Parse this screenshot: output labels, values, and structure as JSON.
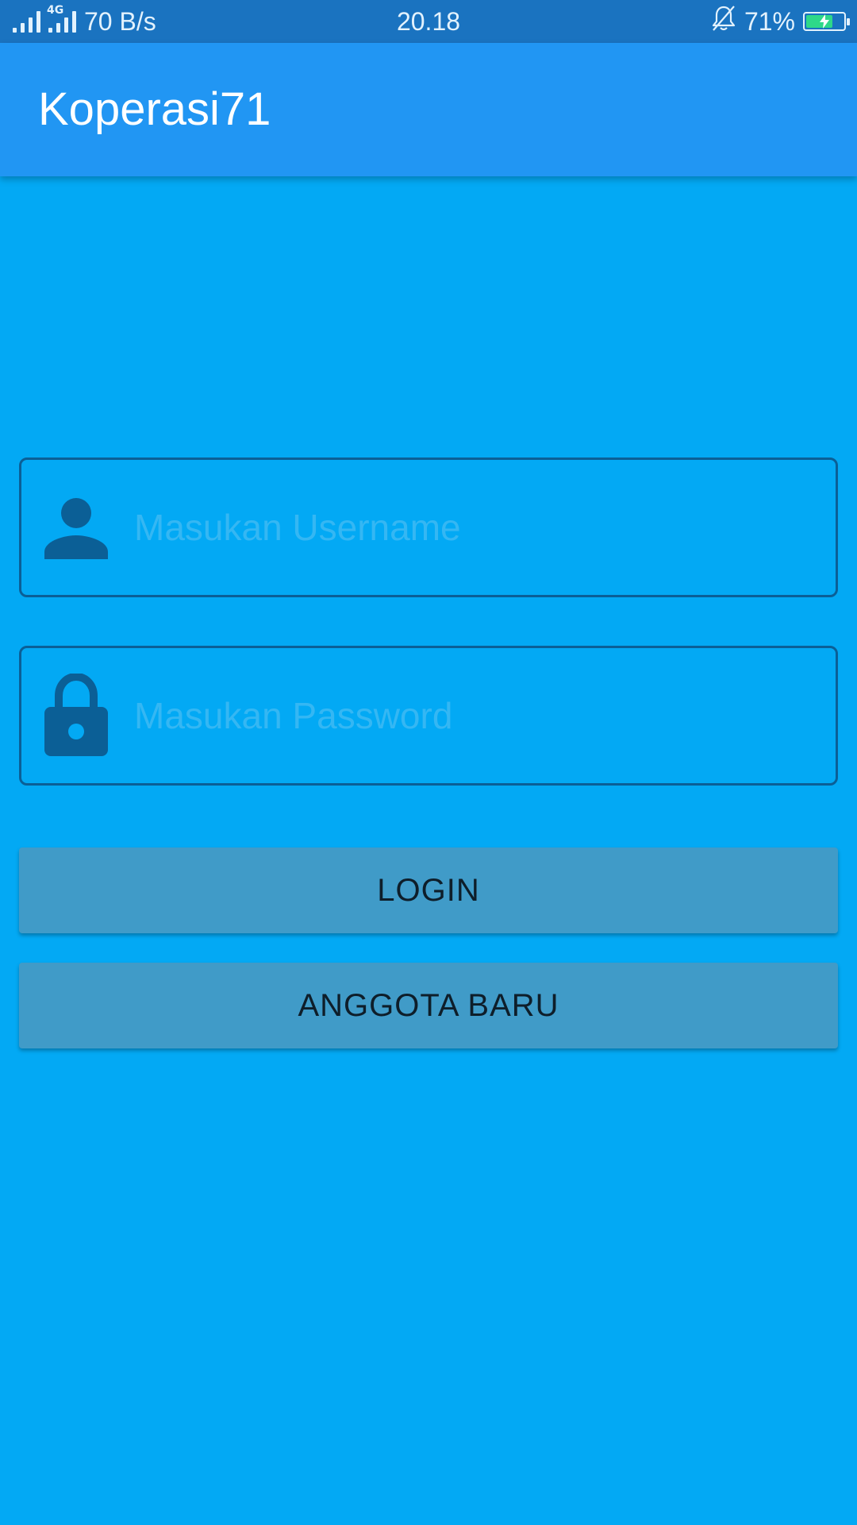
{
  "status_bar": {
    "network_type": "4G",
    "speed": "70 B/s",
    "time": "20.18",
    "battery_percent": "71%",
    "battery_level": 0.71,
    "icons": [
      "signal-icon",
      "signal-4g-icon",
      "bell-off-icon",
      "battery-charging-icon"
    ]
  },
  "app_bar": {
    "title": "Koperasi71"
  },
  "login_form": {
    "username": {
      "placeholder": "Masukan Username",
      "value": "",
      "icon": "user-icon"
    },
    "password": {
      "placeholder": "Masukan Password",
      "value": "",
      "icon": "lock-icon"
    },
    "login_label": "LOGIN",
    "new_member_label": "ANGGOTA BARU"
  },
  "colors": {
    "background": "#03A9F4",
    "app_bar": "#2196F3",
    "status_bar": "#1A73C0",
    "field_border": "#0B5F96",
    "placeholder": "#35B7F3",
    "button": "#409BC8",
    "button_text": "#0E1E2A",
    "battery_fill": "#2ED889"
  }
}
